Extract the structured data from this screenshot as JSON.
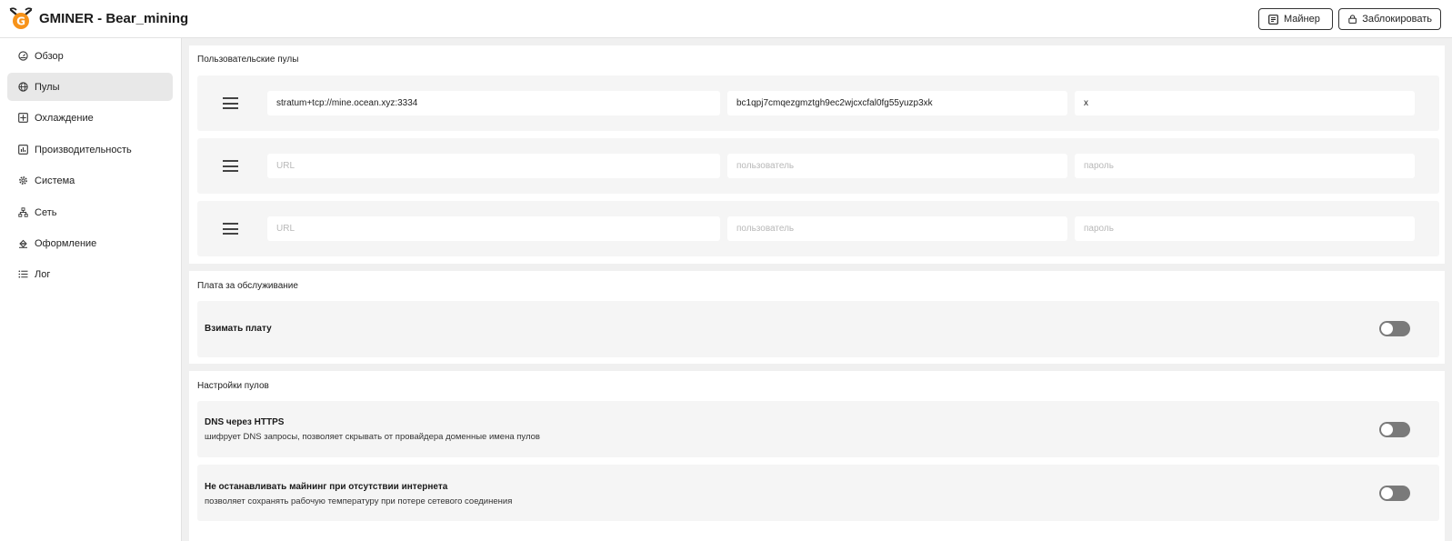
{
  "app": {
    "title": "GMINER - Bear_mining"
  },
  "topbar": {
    "miner_label": "Майнер",
    "lock_label": "Заблокировать"
  },
  "sidebar": {
    "items": [
      {
        "label": "Обзор",
        "icon": "gauge-icon"
      },
      {
        "label": "Пулы",
        "icon": "globe-icon",
        "active": true
      },
      {
        "label": "Охлаждение",
        "icon": "fan-icon"
      },
      {
        "label": "Производительность",
        "icon": "bar-chart-icon"
      },
      {
        "label": "Система",
        "icon": "gear-icon"
      },
      {
        "label": "Сеть",
        "icon": "network-icon"
      },
      {
        "label": "Оформление",
        "icon": "paint-icon"
      },
      {
        "label": "Лог",
        "icon": "list-icon"
      }
    ]
  },
  "pools": {
    "title": "Пользовательские пулы",
    "rows": [
      {
        "url": "stratum+tcp://mine.ocean.xyz:3334",
        "user": "bc1qpj7cmqezgmztgh9ec2wjcxcfal0fg55yuzp3xk",
        "pass": "x"
      },
      {
        "url": "",
        "user": "",
        "pass": ""
      },
      {
        "url": "",
        "user": "",
        "pass": ""
      }
    ],
    "placeholders": {
      "url": "URL",
      "user": "пользователь",
      "pass": "пароль"
    }
  },
  "fee": {
    "title": "Плата за обслуживание",
    "charge_label": "Взимать плату",
    "charge_enabled": false
  },
  "pool_settings": {
    "title": "Настройки пулов",
    "doh": {
      "label": "DNS через HTTPS",
      "desc": "шифрует DNS запросы, позволяет скрывать от провайдера доменные имена пулов",
      "enabled": false
    },
    "no_stop": {
      "label": "Не останавливать майнинг при отсутствии интернета",
      "desc": "позволяет сохранять рабочую температуру при потере сетевого соединения",
      "enabled": false
    }
  },
  "colors": {
    "accent": "#f7931a",
    "toggle_off": "#7a7a7a",
    "active_nav": "#e8e8e8"
  }
}
